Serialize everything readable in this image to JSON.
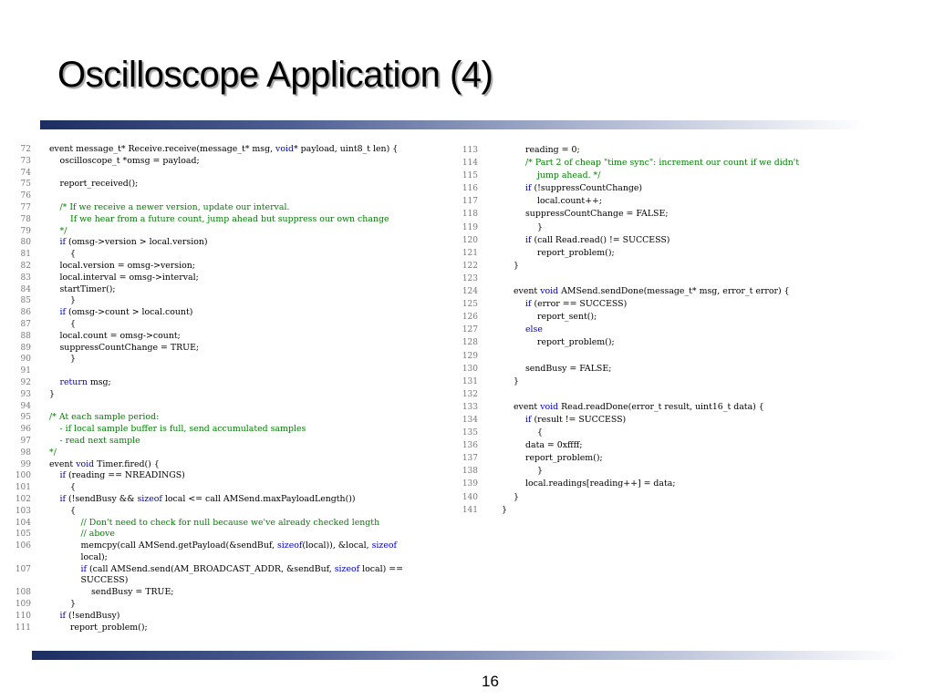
{
  "slide": {
    "title": "Oscilloscope Application (4)",
    "page_number": "16"
  },
  "colors": {
    "keyword": "#0000c8",
    "comment": "#008000",
    "text": "#000000",
    "line_number": "#777777",
    "rule_dark": "#1c2e61"
  },
  "code_left": [
    {
      "n": "72",
      "ind": 0,
      "t": [
        [
          "event message_t* Receive.receive(message_t* msg, ",
          "pl"
        ],
        [
          "void",
          "kw"
        ],
        [
          "* payload, uint8_t len) {",
          "pl"
        ]
      ]
    },
    {
      "n": "73",
      "ind": 1,
      "t": [
        [
          "oscilloscope_t *omsg = payload;",
          "pl"
        ]
      ]
    },
    {
      "n": "74",
      "ind": 0,
      "t": []
    },
    {
      "n": "75",
      "ind": 1,
      "t": [
        [
          "report_received();",
          "pl"
        ]
      ]
    },
    {
      "n": "76",
      "ind": 0,
      "t": []
    },
    {
      "n": "77",
      "ind": 1,
      "t": [
        [
          "/* If we receive a newer version, update our interval.",
          "cm"
        ]
      ]
    },
    {
      "n": "78",
      "ind": 2,
      "t": [
        [
          "If we hear from a future count, jump ahead but suppress our own change",
          "cm"
        ]
      ]
    },
    {
      "n": "79",
      "ind": 1,
      "t": [
        [
          "*/",
          "cm"
        ]
      ]
    },
    {
      "n": "80",
      "ind": 1,
      "t": [
        [
          "if",
          "kw"
        ],
        [
          " (omsg->version > local.version)",
          "pl"
        ]
      ]
    },
    {
      "n": "81",
      "ind": 2,
      "t": [
        [
          "{",
          "pl"
        ]
      ]
    },
    {
      "n": "82",
      "ind": 1,
      "t": [
        [
          "local.version = omsg->version;",
          "pl"
        ]
      ]
    },
    {
      "n": "83",
      "ind": 1,
      "t": [
        [
          "local.interval = omsg->interval;",
          "pl"
        ]
      ]
    },
    {
      "n": "84",
      "ind": 1,
      "t": [
        [
          "startTimer();",
          "pl"
        ]
      ]
    },
    {
      "n": "85",
      "ind": 2,
      "t": [
        [
          "}",
          "pl"
        ]
      ]
    },
    {
      "n": "86",
      "ind": 1,
      "t": [
        [
          "if",
          "kw"
        ],
        [
          " (omsg->count > local.count)",
          "pl"
        ]
      ]
    },
    {
      "n": "87",
      "ind": 2,
      "t": [
        [
          "{",
          "pl"
        ]
      ]
    },
    {
      "n": "88",
      "ind": 1,
      "t": [
        [
          "local.count = omsg->count;",
          "pl"
        ]
      ]
    },
    {
      "n": "89",
      "ind": 1,
      "t": [
        [
          "suppressCountChange = TRUE;",
          "pl"
        ]
      ]
    },
    {
      "n": "90",
      "ind": 2,
      "t": [
        [
          "}",
          "pl"
        ]
      ]
    },
    {
      "n": "91",
      "ind": 0,
      "t": []
    },
    {
      "n": "92",
      "ind": 1,
      "t": [
        [
          "return",
          "kw"
        ],
        [
          " msg;",
          "pl"
        ]
      ]
    },
    {
      "n": "93",
      "ind": 0,
      "t": [
        [
          "}",
          "pl"
        ]
      ]
    },
    {
      "n": "94",
      "ind": 0,
      "t": []
    },
    {
      "n": "95",
      "ind": 0,
      "t": [
        [
          "/* At each sample period:",
          "cm"
        ]
      ]
    },
    {
      "n": "96",
      "ind": 1,
      "t": [
        [
          "- if local sample buffer is full, send accumulated samples",
          "cm"
        ]
      ]
    },
    {
      "n": "97",
      "ind": 1,
      "t": [
        [
          "- read next sample",
          "cm"
        ]
      ]
    },
    {
      "n": "98",
      "ind": 0,
      "t": [
        [
          "*/",
          "cm"
        ]
      ]
    },
    {
      "n": "99",
      "ind": 0,
      "t": [
        [
          "event ",
          "pl"
        ],
        [
          "void",
          "kw"
        ],
        [
          " Timer.fired() {",
          "pl"
        ]
      ]
    },
    {
      "n": "100",
      "ind": 1,
      "t": [
        [
          "if",
          "kw"
        ],
        [
          " (reading == NREADINGS)",
          "pl"
        ]
      ]
    },
    {
      "n": "101",
      "ind": 2,
      "t": [
        [
          "{",
          "pl"
        ]
      ]
    },
    {
      "n": "102",
      "ind": 1,
      "t": [
        [
          "if",
          "kw"
        ],
        [
          " (!sendBusy && ",
          "pl"
        ],
        [
          "sizeof",
          "kw"
        ],
        [
          " local <= call AMSend.maxPayloadLength())",
          "pl"
        ]
      ]
    },
    {
      "n": "103",
      "ind": 2,
      "t": [
        [
          "{",
          "pl"
        ]
      ]
    },
    {
      "n": "104",
      "ind": 3,
      "t": [
        [
          "// Don't need to check for null because we've already checked length",
          "cm"
        ]
      ]
    },
    {
      "n": "105",
      "ind": 3,
      "t": [
        [
          "// above",
          "cm"
        ]
      ]
    },
    {
      "n": "106",
      "ind": 3,
      "t": [
        [
          "memcpy(call AMSend.getPayload(&sendBuf, ",
          "pl"
        ],
        [
          "sizeof",
          "kw"
        ],
        [
          "(local)), &local, ",
          "pl"
        ],
        [
          "sizeof",
          "kw"
        ],
        [
          "\nlocal);",
          "pl"
        ]
      ]
    },
    {
      "n": "107",
      "ind": 3,
      "t": [
        [
          "if",
          "kw"
        ],
        [
          " (call AMSend.send(AM_BROADCAST_ADDR, &sendBuf, ",
          "pl"
        ],
        [
          "sizeof",
          "kw"
        ],
        [
          " local) ==\nSUCCESS)",
          "pl"
        ]
      ]
    },
    {
      "n": "108",
      "ind": 4,
      "t": [
        [
          "sendBusy = TRUE;",
          "pl"
        ]
      ]
    },
    {
      "n": "109",
      "ind": 2,
      "t": [
        [
          "}",
          "pl"
        ]
      ]
    },
    {
      "n": "110",
      "ind": 1,
      "t": [
        [
          "if",
          "kw"
        ],
        [
          " (!sendBusy)",
          "pl"
        ]
      ]
    },
    {
      "n": "111",
      "ind": 2,
      "t": [
        [
          "report_problem();",
          "pl"
        ]
      ]
    }
  ],
  "code_right": [
    {
      "n": "113",
      "ind": 2,
      "t": [
        [
          "reading = 0;",
          "pl"
        ]
      ]
    },
    {
      "n": "114",
      "ind": 2,
      "t": [
        [
          "/* Part 2 of cheap \"time sync\": increment our count if we didn't",
          "cm"
        ]
      ]
    },
    {
      "n": "115",
      "ind": 3,
      "t": [
        [
          "jump ahead. */",
          "cm"
        ]
      ]
    },
    {
      "n": "116",
      "ind": 2,
      "t": [
        [
          "if",
          "kw"
        ],
        [
          " (!suppressCountChange)",
          "pl"
        ]
      ]
    },
    {
      "n": "117",
      "ind": 3,
      "t": [
        [
          "local.count++;",
          "pl"
        ]
      ]
    },
    {
      "n": "118",
      "ind": 2,
      "t": [
        [
          "suppressCountChange = FALSE;",
          "pl"
        ]
      ]
    },
    {
      "n": "119",
      "ind": 3,
      "t": [
        [
          "}",
          "pl"
        ]
      ]
    },
    {
      "n": "120",
      "ind": 2,
      "t": [
        [
          "if",
          "kw"
        ],
        [
          " (call Read.read() != SUCCESS)",
          "pl"
        ]
      ]
    },
    {
      "n": "121",
      "ind": 3,
      "t": [
        [
          "report_problem();",
          "pl"
        ]
      ]
    },
    {
      "n": "122",
      "ind": 1,
      "t": [
        [
          "}",
          "pl"
        ]
      ]
    },
    {
      "n": "123",
      "ind": 0,
      "t": []
    },
    {
      "n": "124",
      "ind": 1,
      "t": [
        [
          "event ",
          "pl"
        ],
        [
          "void",
          "kw"
        ],
        [
          " AMSend.sendDone(message_t* msg, error_t error) {",
          "pl"
        ]
      ]
    },
    {
      "n": "125",
      "ind": 2,
      "t": [
        [
          "if",
          "kw"
        ],
        [
          " (error == SUCCESS)",
          "pl"
        ]
      ]
    },
    {
      "n": "126",
      "ind": 3,
      "t": [
        [
          "report_sent();",
          "pl"
        ]
      ]
    },
    {
      "n": "127",
      "ind": 2,
      "t": [
        [
          "else",
          "kw"
        ]
      ]
    },
    {
      "n": "128",
      "ind": 3,
      "t": [
        [
          "report_problem();",
          "pl"
        ]
      ]
    },
    {
      "n": "129",
      "ind": 0,
      "t": []
    },
    {
      "n": "130",
      "ind": 2,
      "t": [
        [
          "sendBusy = FALSE;",
          "pl"
        ]
      ]
    },
    {
      "n": "131",
      "ind": 1,
      "t": [
        [
          "}",
          "pl"
        ]
      ]
    },
    {
      "n": "132",
      "ind": 0,
      "t": []
    },
    {
      "n": "133",
      "ind": 1,
      "t": [
        [
          "event ",
          "pl"
        ],
        [
          "void",
          "kw"
        ],
        [
          " Read.readDone(error_t result, uint16_t data) {",
          "pl"
        ]
      ]
    },
    {
      "n": "134",
      "ind": 2,
      "t": [
        [
          "if",
          "kw"
        ],
        [
          " (result != SUCCESS)",
          "pl"
        ]
      ]
    },
    {
      "n": "135",
      "ind": 3,
      "t": [
        [
          "{",
          "pl"
        ]
      ]
    },
    {
      "n": "136",
      "ind": 2,
      "t": [
        [
          "data = 0xffff;",
          "pl"
        ]
      ]
    },
    {
      "n": "137",
      "ind": 2,
      "t": [
        [
          "report_problem();",
          "pl"
        ]
      ]
    },
    {
      "n": "138",
      "ind": 3,
      "t": [
        [
          "}",
          "pl"
        ]
      ]
    },
    {
      "n": "139",
      "ind": 2,
      "t": [
        [
          "local.readings[reading++] = data;",
          "pl"
        ]
      ]
    },
    {
      "n": "140",
      "ind": 1,
      "t": [
        [
          "}",
          "pl"
        ]
      ]
    },
    {
      "n": "141",
      "ind": 0,
      "t": [
        [
          "}",
          "pl"
        ]
      ]
    }
  ]
}
